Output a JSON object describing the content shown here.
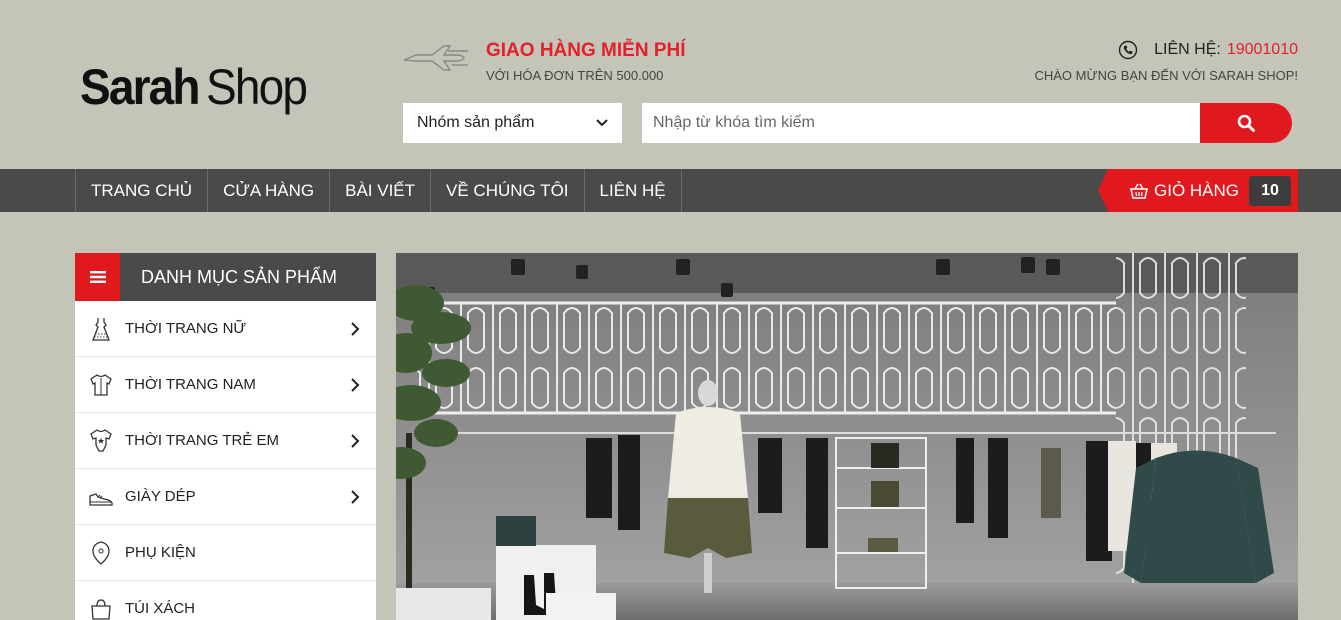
{
  "brand": {
    "bold": "Sarah",
    "light": "Shop"
  },
  "shipping": {
    "title": "GIAO HÀNG MIỄN PHÍ",
    "subtitle": "VỚI HÓA ĐƠN TRÊN 500.000"
  },
  "contact": {
    "label": "LIÊN HỆ:",
    "phone": "19001010",
    "welcome": "CHÀO MỪNG BẠN ĐẾN VỚI SARAH SHOP!"
  },
  "search": {
    "category_selected": "Nhóm sản phẩm",
    "placeholder": "Nhập từ khóa tìm kiếm"
  },
  "nav": {
    "items": [
      "TRANG CHỦ",
      "CỬA HÀNG",
      "BÀI VIẾT",
      "VỀ CHÚNG TÔI",
      "LIÊN HỆ"
    ],
    "cart_label": "GIỎ HÀNG",
    "cart_count": "10"
  },
  "sidebar": {
    "title": "DANH MỤC SẢN PHẨM",
    "items": [
      {
        "label": "THỜI TRANG NỮ",
        "icon": "dress-icon"
      },
      {
        "label": "THỜI TRANG NAM",
        "icon": "shirt-icon"
      },
      {
        "label": "THỜI TRANG TRẺ EM",
        "icon": "baby-onesie-icon"
      },
      {
        "label": "GIÀY DÉP",
        "icon": "shoe-icon"
      },
      {
        "label": "PHỤ KIỆN",
        "icon": "pendant-icon"
      },
      {
        "label": "TÚI XÁCH",
        "icon": "bag-icon"
      }
    ]
  },
  "colors": {
    "accent": "#e0191f",
    "nav_bg": "#4a4a4a",
    "page_bg": "#c5c4b8"
  }
}
